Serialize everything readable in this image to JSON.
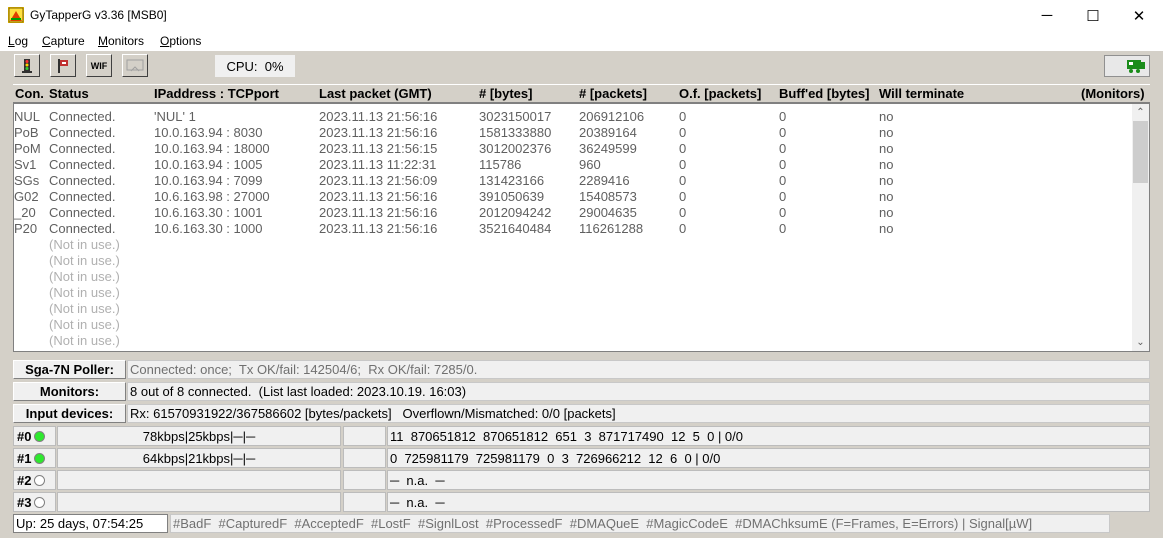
{
  "window": {
    "title": "GyTapperG  v3.36  [MSB0]",
    "minimize_glyph": "─",
    "maximize_glyph": "☐",
    "close_glyph": "✕"
  },
  "menu": {
    "items": [
      {
        "label": "Log"
      },
      {
        "label": "Capture"
      },
      {
        "label": "Monitors"
      },
      {
        "label": "Options"
      }
    ]
  },
  "toolbar": {
    "buttons": [
      {
        "icon": "traffic-light-icon"
      },
      {
        "icon": "flag-icon"
      },
      {
        "label": "WIF",
        "icon": "wif-icon"
      },
      {
        "icon": "disabled-tool-icon"
      }
    ],
    "cpu_text": "CPU:  0%",
    "status_icon": "connection-status-icon"
  },
  "list": {
    "headers": [
      "Con.",
      "Status",
      "IPaddress : TCPport",
      "Last packet (GMT)",
      "# [bytes]",
      "# [packets]",
      "O.f. [packets]",
      "Buff'ed [bytes]",
      "Will terminate",
      "(Monitors)"
    ],
    "rows": [
      {
        "con": "NUL",
        "status": "Connected.",
        "ip": "'NUL' 1",
        "last": "2023.11.13 21:56:16",
        "bytes": "3023150017",
        "packets": "206912106",
        "of": "0",
        "buff": "0",
        "term": "no"
      },
      {
        "con": "PoB",
        "status": "Connected.",
        "ip": "10.0.163.94 : 8030",
        "last": "2023.11.13 21:56:16",
        "bytes": "1581333880",
        "packets": "20389164",
        "of": "0",
        "buff": "0",
        "term": "no"
      },
      {
        "con": "PoM",
        "status": "Connected.",
        "ip": "10.0.163.94 : 18000",
        "last": "2023.11.13 21:56:15",
        "bytes": "3012002376",
        "packets": "36249599",
        "of": "0",
        "buff": "0",
        "term": "no"
      },
      {
        "con": "Sv1",
        "status": "Connected.",
        "ip": "10.0.163.94 : 1005",
        "last": "2023.11.13 11:22:31",
        "bytes": "115786",
        "packets": "960",
        "of": "0",
        "buff": "0",
        "term": "no"
      },
      {
        "con": "SGs",
        "status": "Connected.",
        "ip": "10.0.163.94 : 7099",
        "last": "2023.11.13 21:56:09",
        "bytes": "131423166",
        "packets": "2289416",
        "of": "0",
        "buff": "0",
        "term": "no"
      },
      {
        "con": "G02",
        "status": "Connected.",
        "ip": "10.6.163.98 : 27000",
        "last": "2023.11.13 21:56:16",
        "bytes": "391050639",
        "packets": "15408573",
        "of": "0",
        "buff": "0",
        "term": "no"
      },
      {
        "con": "_20",
        "status": "Connected.",
        "ip": "10.6.163.30 : 1001",
        "last": "2023.11.13 21:56:16",
        "bytes": "2012094242",
        "packets": "29004635",
        "of": "0",
        "buff": "0",
        "term": "no"
      },
      {
        "con": "P20",
        "status": "Connected.",
        "ip": "10.6.163.30 : 1000",
        "last": "2023.11.13 21:56:16",
        "bytes": "3521640484",
        "packets": "116261288",
        "of": "0",
        "buff": "0",
        "term": "no"
      },
      {
        "con": "",
        "status": "(Not in use.)"
      },
      {
        "con": "",
        "status": "(Not in use.)"
      },
      {
        "con": "",
        "status": "(Not in use.)"
      },
      {
        "con": "",
        "status": "(Not in use.)"
      },
      {
        "con": "",
        "status": "(Not in use.)"
      },
      {
        "con": "",
        "status": "(Not in use.)"
      },
      {
        "con": "",
        "status": "(Not in use.)"
      }
    ]
  },
  "info": {
    "poller_label": "Sga-7N Poller:",
    "poller_value": "Connected: once;  Tx OK/fail: 142504/6;  Rx OK/fail: 7285/0.",
    "monitors_label": "Monitors:",
    "monitors_value": "8 out of 8 connected.  (List last loaded: 2023.10.19. 16:03)",
    "input_label": "Input devices:",
    "input_value": "Rx: 61570931922/367586602 [bytes/packets]   Overflown/Mismatched: 0/0 [packets]"
  },
  "monitors": [
    {
      "id": "#0",
      "active": true,
      "rate": "78kbps|25kbps|─|─",
      "stats": "11  870651812  870651812  651  3  871717490  12  5  0 | 0/0"
    },
    {
      "id": "#1",
      "active": true,
      "rate": "64kbps|21kbps|─|─",
      "stats": "0  725981179  725981179  0  3  726966212  12  6  0 | 0/0"
    },
    {
      "id": "#2",
      "active": false,
      "rate": "",
      "stats": "─  n.a.  ─"
    },
    {
      "id": "#3",
      "active": false,
      "rate": "",
      "stats": "─  n.a.  ─"
    }
  ],
  "footer": {
    "uptime": "Up: 25 days, 07:54:25",
    "legend": "#BadF  #CapturedF  #AcceptedF  #LostF  #SignlLost  #ProcessedF  #DMAQueE  #MagicCodeE  #DMAChksumE (F=Frames, E=Errors) | Signal[µW]"
  },
  "colors": {
    "monitor_active": "#2ee82e",
    "panel": "#d4d0c8"
  }
}
